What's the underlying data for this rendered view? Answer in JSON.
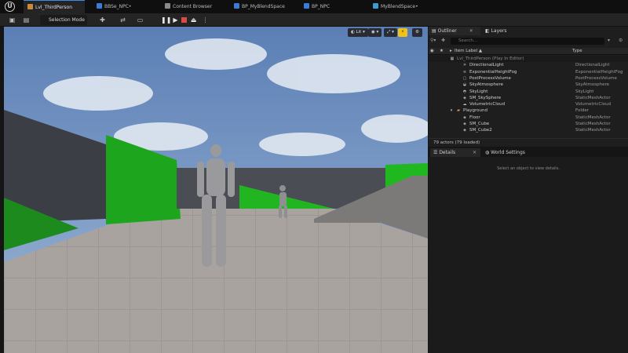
{
  "tabs": [
    {
      "label": "Lvl_ThirdPerson",
      "active": true
    },
    {
      "label": "BBSe_NPC•",
      "active": false
    },
    {
      "label": "Content Browser",
      "active": false
    },
    {
      "label": "BP_MyBlendSpace",
      "active": false
    },
    {
      "label": "BP_NPC",
      "active": false
    },
    {
      "label": "MyBlendSpace•",
      "active": false
    }
  ],
  "toolbar": {
    "mode_label": "Selection Mode"
  },
  "viewport": {
    "lit_label": "Lit"
  },
  "outliner": {
    "tab_label": "Outliner",
    "layers_tab_label": "Layers",
    "search_placeholder": "Search...",
    "col_label": "Item Label ▲",
    "col_type": "Type",
    "rows": [
      {
        "label": "Lvl_ThirdPerson (Play In Editor)",
        "type": "",
        "indent": 0,
        "header": true,
        "icon": "level-icon"
      },
      {
        "label": "DirectionalLight",
        "type": "DirectionalLight",
        "indent": 2,
        "icon": "light-icon"
      },
      {
        "label": "ExponentialHeightFog",
        "type": "ExponentialHeightFog",
        "indent": 2,
        "icon": "fog-icon"
      },
      {
        "label": "PostProcessVolume",
        "type": "PostProcessVolume",
        "indent": 2,
        "icon": "volume-icon"
      },
      {
        "label": "SkyAtmosphere",
        "type": "SkyAtmosphere",
        "indent": 2,
        "icon": "sky-icon"
      },
      {
        "label": "SkyLight",
        "type": "SkyLight",
        "indent": 2,
        "icon": "skylight-icon"
      },
      {
        "label": "SM_SkySphere",
        "type": "StaticMeshActor",
        "indent": 2,
        "icon": "mesh-icon"
      },
      {
        "label": "VolumetricCloud",
        "type": "VolumetricCloud",
        "indent": 2,
        "icon": "cloud-icon"
      },
      {
        "label": "Playground",
        "type": "Folder",
        "indent": 1,
        "icon": "folder-icon",
        "folder": true
      },
      {
        "label": "Floor",
        "type": "StaticMeshActor",
        "indent": 2,
        "icon": "mesh-icon"
      },
      {
        "label": "SM_Cube",
        "type": "StaticMeshActor",
        "indent": 2,
        "icon": "mesh-icon"
      },
      {
        "label": "SM_Cube2",
        "type": "StaticMeshActor",
        "indent": 2,
        "icon": "mesh-icon"
      }
    ],
    "footer": "79 actors (79 loaded)"
  },
  "details": {
    "tab_label": "Details",
    "world_tab_label": "World Settings",
    "empty_hint": "Select an object to view details."
  }
}
